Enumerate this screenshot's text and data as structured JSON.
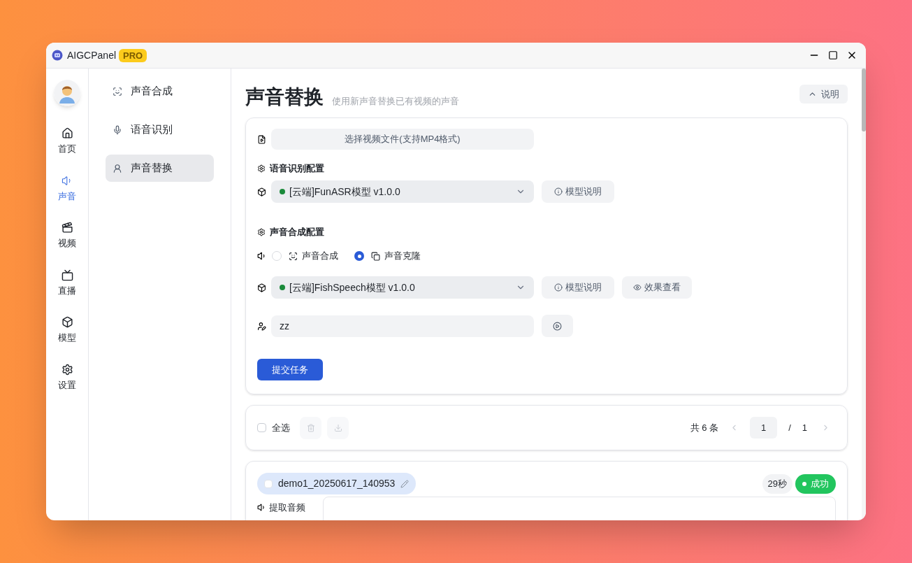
{
  "window": {
    "title": "AIGCPanel",
    "badge": "PRO"
  },
  "rail": [
    {
      "label": "首页",
      "selected": false
    },
    {
      "label": "声音",
      "selected": true
    },
    {
      "label": "视频",
      "selected": false
    },
    {
      "label": "直播",
      "selected": false
    },
    {
      "label": "模型",
      "selected": false
    },
    {
      "label": "设置",
      "selected": false
    }
  ],
  "submenu": [
    {
      "label": "声音合成",
      "selected": false
    },
    {
      "label": "语音识别",
      "selected": false
    },
    {
      "label": "声音替换",
      "selected": true
    }
  ],
  "page": {
    "title": "声音替换",
    "subtitle": "使用新声音替换已有视频的声音",
    "help_button": {
      "label": "说明",
      "expanded": true
    }
  },
  "form": {
    "file_button": "选择视频文件(支持MP4格式)",
    "asr": {
      "title": "语音识别配置",
      "model": "[云端]FunASR模型 v1.0.0",
      "info_button": "模型说明"
    },
    "tts": {
      "title": "声音合成配置",
      "modes": [
        {
          "label": "声音合成",
          "selected": false
        },
        {
          "label": "声音克隆",
          "selected": true
        }
      ],
      "model": "[云端]FishSpeech模型 v1.0.0",
      "info_button": "模型说明",
      "preview_button": "效果查看",
      "voice": "zz"
    },
    "submit": "提交任务"
  },
  "toolbar": {
    "select_all": {
      "label": "全选",
      "checked": false
    },
    "count": "共 6 条",
    "page": "1",
    "separator": "/",
    "total": "1"
  },
  "task": {
    "name": "demo1_20250617_140953",
    "checked": false,
    "duration": "29秒",
    "status": "成功",
    "step": "提取音频"
  }
}
